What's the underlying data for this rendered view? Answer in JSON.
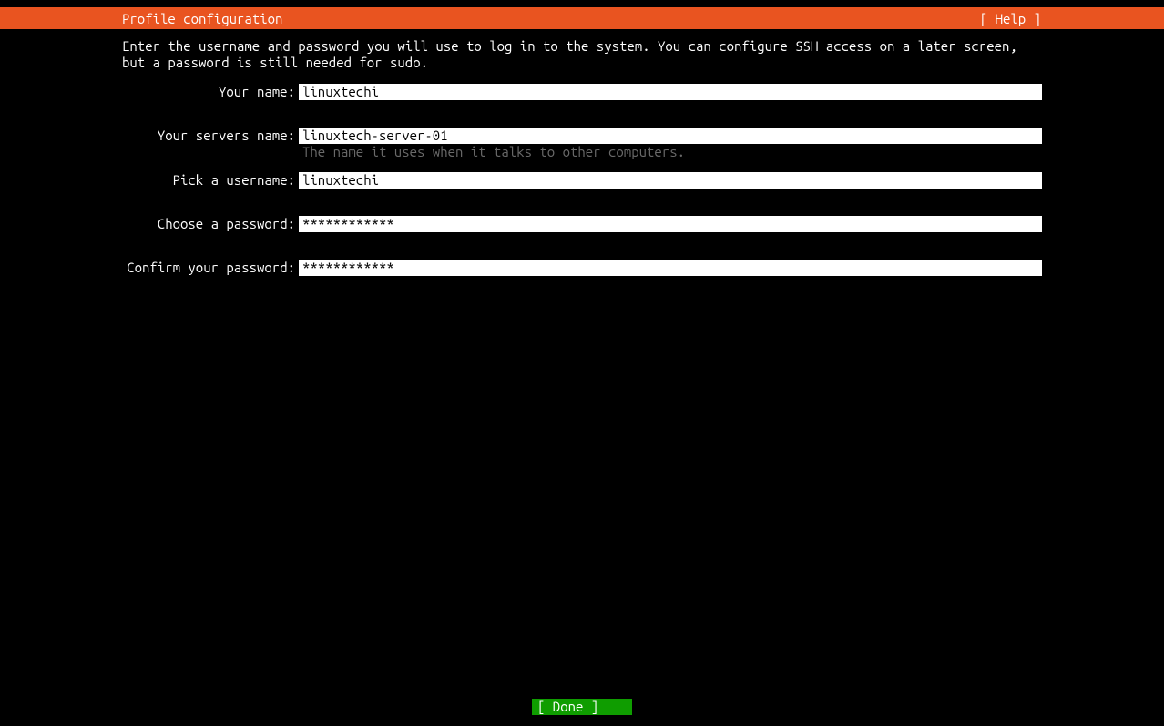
{
  "header": {
    "title": "Profile configuration",
    "help": "[ Help ]"
  },
  "description": "Enter the username and password you will use to log in to the system. You can configure SSH access on a later screen, but a password is still needed for sudo.",
  "fields": {
    "your_name": {
      "label": "Your name:",
      "value": "linuxtechi"
    },
    "server_name": {
      "label": "Your servers name:",
      "value": "linuxtech-server-01",
      "hint": "The name it uses when it talks to other computers."
    },
    "username": {
      "label": "Pick a username:",
      "value": "linuxtechi"
    },
    "password": {
      "label": "Choose a password:",
      "value": "************"
    },
    "confirm_password": {
      "label": "Confirm your password:",
      "value": "************"
    }
  },
  "footer": {
    "done": "[ Done       ]"
  }
}
